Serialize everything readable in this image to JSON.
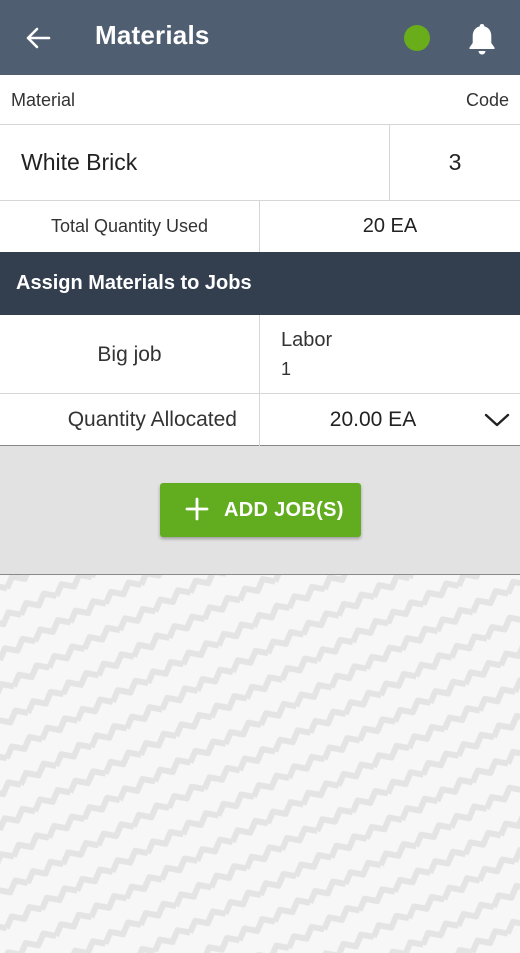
{
  "header": {
    "title": "Materials",
    "back_icon": "arrow-left-icon",
    "status_color": "#6aad1b",
    "bell_icon": "bell-icon"
  },
  "table_header": {
    "material_label": "Material",
    "code_label": "Code"
  },
  "material": {
    "name": "White Brick",
    "code": "3"
  },
  "quantity": {
    "label": "Total Quantity Used",
    "value": "20 EA"
  },
  "assign_section": {
    "title": "Assign Materials to Jobs"
  },
  "job": {
    "name": "Big job",
    "type": "Labor",
    "number": "1"
  },
  "allocation": {
    "label": "Quantity Allocated",
    "value": "20.00 EA",
    "dropdown_icon": "chevron-down-icon"
  },
  "add_job_button": {
    "label": "ADD JOB(S)",
    "icon": "plus-icon",
    "color": "#62ad1f"
  },
  "colors": {
    "topbar": "#4f5e70",
    "section_header": "#333f4f"
  }
}
